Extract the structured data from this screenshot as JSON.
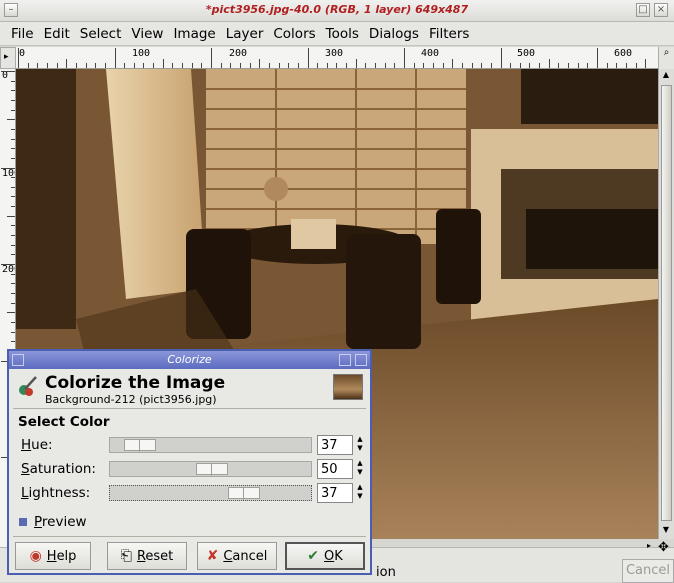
{
  "window": {
    "title": "*pict3956.jpg-40.0 (RGB, 1 layer) 649x487",
    "menu": [
      "File",
      "Edit",
      "Select",
      "View",
      "Image",
      "Layer",
      "Colors",
      "Tools",
      "Dialogs",
      "Filters"
    ]
  },
  "rulers": {
    "top_labels": [
      "0",
      "100",
      "200",
      "300",
      "400",
      "500",
      "600"
    ],
    "left_labels": [
      "0",
      "100",
      "200"
    ]
  },
  "status": {
    "message": "ion",
    "cancel_label": "Cancel"
  },
  "dialog": {
    "title": "Colorize",
    "heading": "Colorize the Image",
    "subheading": "Background-212 (pict3956.jpg)",
    "section": "Select Color",
    "hue": {
      "label_u": "H",
      "label_rest": "ue:",
      "value": "37"
    },
    "saturation": {
      "label_u": "S",
      "label_rest": "aturation:",
      "value": "50"
    },
    "lightness": {
      "label_u": "L",
      "label_rest": "ightness:",
      "value": "37"
    },
    "preview": {
      "label_u": "P",
      "label_rest": "review",
      "checked": true
    },
    "buttons": {
      "help": {
        "u": "H",
        "rest": "elp"
      },
      "reset": {
        "u": "R",
        "rest": "eset"
      },
      "cancel": {
        "u": "C",
        "rest": "ancel"
      },
      "ok": {
        "u": "O",
        "rest": "K"
      }
    }
  },
  "colors": {
    "dialog_title": "#5c6bc0",
    "title_text": "#b02020",
    "sepia": "#a57b4c"
  }
}
